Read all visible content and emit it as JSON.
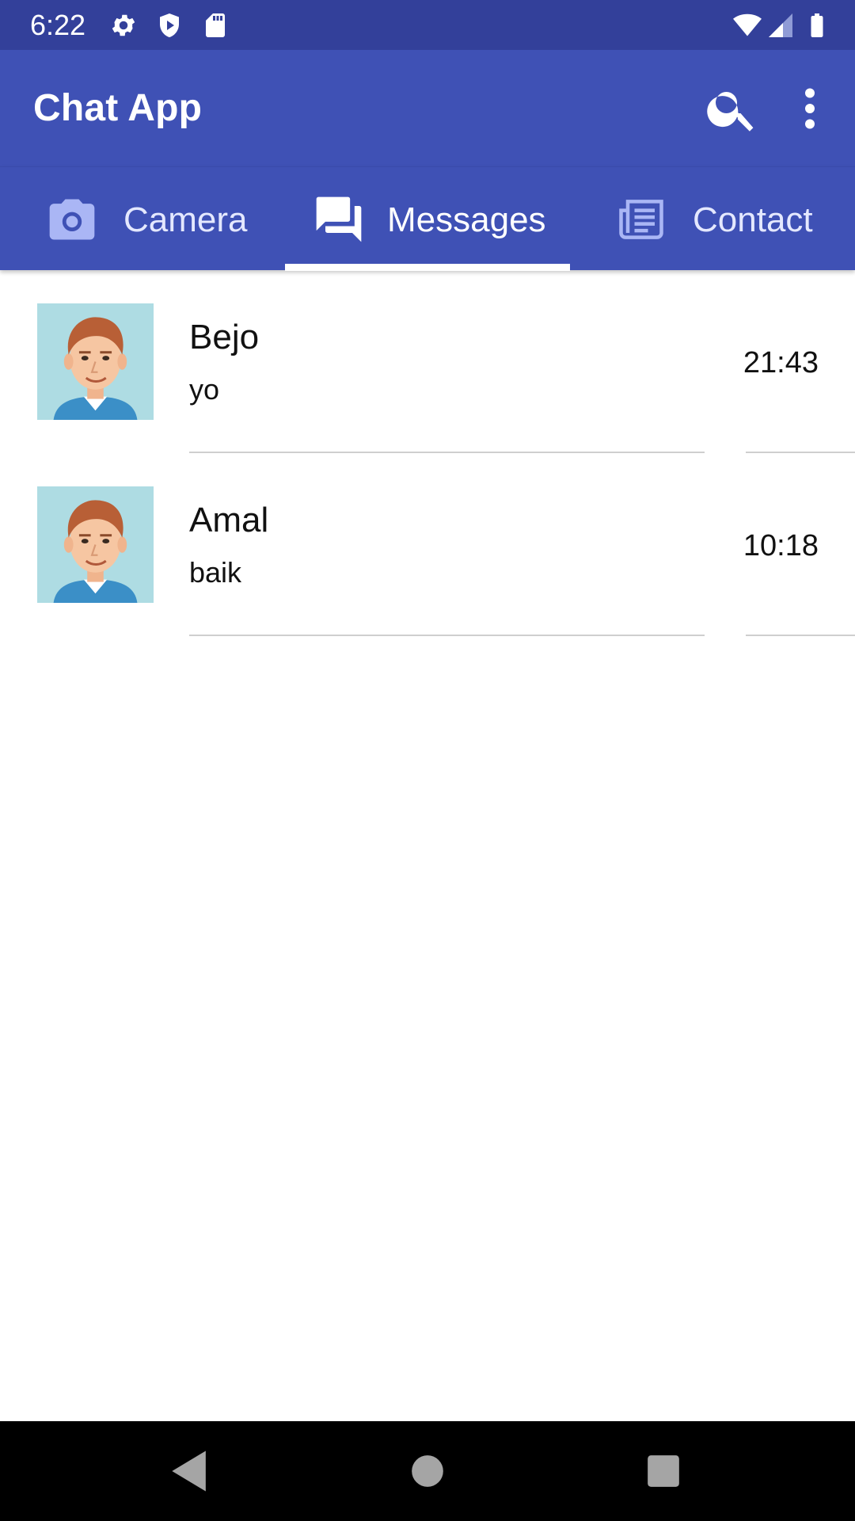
{
  "status_bar": {
    "time": "6:22",
    "icons_left": [
      "gear-icon",
      "shield-icon",
      "sd-card-icon"
    ],
    "icons_right": [
      "wifi-icon",
      "signal-icon",
      "battery-icon"
    ]
  },
  "app_bar": {
    "title": "Chat App",
    "actions": [
      "search-icon",
      "more-vert-icon"
    ]
  },
  "tabs": [
    {
      "label": "Camera",
      "icon": "camera-icon",
      "selected": false
    },
    {
      "label": "Messages",
      "icon": "chat-icon",
      "selected": true
    },
    {
      "label": "Contact",
      "icon": "newspaper-icon",
      "selected": false
    }
  ],
  "chats": [
    {
      "name": "Bejo",
      "message": "yo",
      "time": "21:43",
      "avatar": "avatar-icon"
    },
    {
      "name": "Amal",
      "message": "baik",
      "time": "10:18",
      "avatar": "avatar-icon"
    }
  ],
  "nav_bar": [
    "back-icon",
    "home-icon",
    "recents-icon"
  ],
  "colors": {
    "status_bar": "#33409a",
    "primary": "#3f51b5",
    "tab_active_text": "#ffffff",
    "tab_inactive_text": "#e4e8ff",
    "tab_inactive_icon": "#aab6f5",
    "divider": "#cfcfcf",
    "nav_bar": "#000000",
    "nav_icon": "#a5a5a5"
  }
}
